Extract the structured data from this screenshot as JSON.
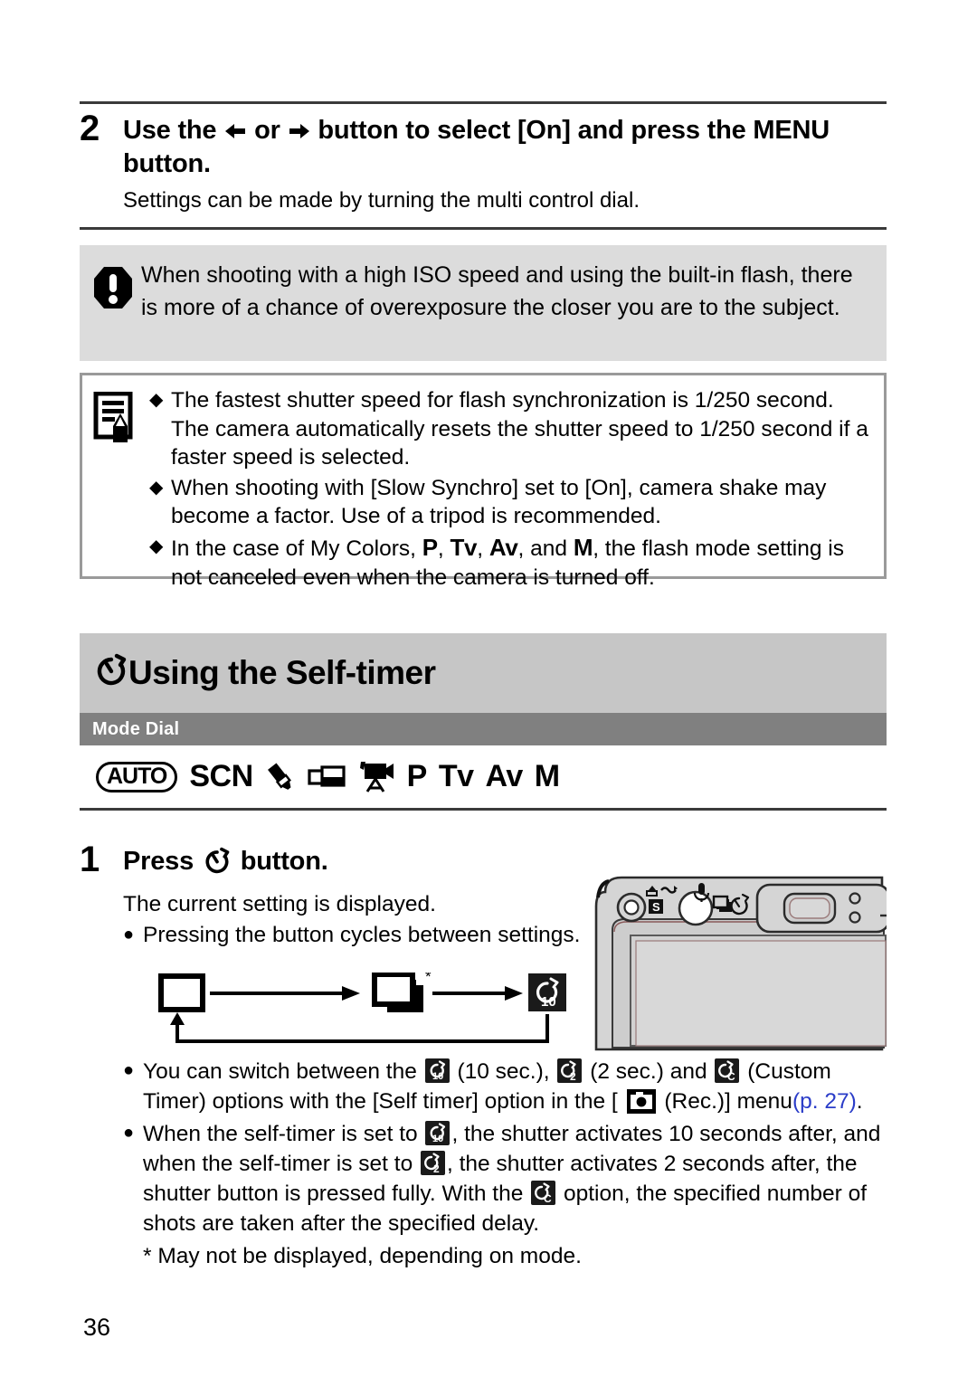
{
  "page": {
    "number": "36",
    "background": "#ffffff"
  },
  "colors": {
    "rule": "#3a3a3a",
    "warn_bg": "#dcdcdc",
    "note_border": "#9a9a9a",
    "section_bg": "#c6c6c6",
    "modebar_bg": "#808080",
    "link": "#2a3cc8"
  },
  "step2": {
    "number": "2",
    "heading_pre": "Use the",
    "icon_left": "left-arrow-icon",
    "heading_or": "or",
    "icon_right": "right-arrow-icon",
    "heading_post": "button to select [On] and press the MENU button.",
    "subtext": "Settings can be made by turning the multi control dial."
  },
  "warning": {
    "icon": "exclamation-octagon-icon",
    "text": "When shooting with a high ISO speed and using the built-in flash, there is more of a chance of overexposure the closer you are to the subject."
  },
  "notes": {
    "icon": "note-pencil-icon",
    "items": [
      {
        "bullet": "◆",
        "text": "The fastest shutter speed for flash synchronization is 1/250 second. The camera automatically resets the shutter speed to 1/250 second if a faster speed is selected."
      },
      {
        "bullet": "◆",
        "text": "When shooting with [Slow Synchro] set to [On], camera shake may become a factor. Use of a tripod is recommended."
      },
      {
        "bullet": "◆",
        "prefix": "In the case of My Colors,",
        "modes": [
          "P",
          "Tv",
          "Av",
          "M"
        ],
        "suffix": ", the flash mode setting is not canceled even when the camera is turned off."
      }
    ]
  },
  "section": {
    "icon": "self-timer-icon",
    "title": "Using the Self-timer",
    "mode_dial_label": "Mode Dial",
    "mode_dial_items": [
      {
        "name": "auto-mode-icon",
        "label": "AUTO",
        "type": "badge"
      },
      {
        "name": "scn-mode-label",
        "label": "SCN",
        "type": "text"
      },
      {
        "name": "color-accent-mode-icon",
        "label": "",
        "type": "icon-brush"
      },
      {
        "name": "stitch-assist-mode-icon",
        "label": "",
        "type": "icon-stitch"
      },
      {
        "name": "movie-mode-icon",
        "label": "",
        "type": "icon-movie"
      },
      {
        "name": "program-mode-label",
        "label": "P",
        "type": "text"
      },
      {
        "name": "tv-mode-label",
        "label": "Tv",
        "type": "text"
      },
      {
        "name": "av-mode-label",
        "label": "Av",
        "type": "text"
      },
      {
        "name": "manual-mode-label",
        "label": "M",
        "type": "text"
      }
    ]
  },
  "step1": {
    "number": "1",
    "heading_pre": "Press",
    "icon": "self-timer-icon",
    "heading_post": "button.",
    "line1": "The current setting is displayed.",
    "bullet1_dot": "●",
    "bullet1": "Pressing the button cycles between settings.",
    "cycle": {
      "items": [
        {
          "name": "single-shot-icon",
          "star": false
        },
        {
          "name": "continuous-shooting-icon",
          "star": true,
          "star_mark": "*"
        },
        {
          "name": "self-timer-10sec-icon",
          "star": false
        }
      ]
    },
    "camera_illustration": {
      "name": "camera-back-illustration",
      "parts": [
        "print-share-button",
        "drive-self-timer-button",
        "microphone-icon",
        "viewfinder",
        "indicator-lamps"
      ]
    }
  },
  "bottom": {
    "b1": {
      "dot": "●",
      "p1": "You can switch between the",
      "icon1": "self-timer-10sec-icon",
      "p2": "(10 sec.),",
      "icon2": "self-timer-2sec-icon",
      "p3": "(2 sec.) and",
      "icon3": "self-timer-custom-icon",
      "p4": "(Custom Timer) options with the [Self timer] option in the [",
      "icon4": "rec-menu-camera-icon",
      "p5": "(Rec.)] menu",
      "ref": "(p. 27)",
      "p6": "."
    },
    "b2": {
      "dot": "●",
      "p1": "When the self-timer is set to",
      "icon1": "self-timer-10sec-icon",
      "p2": ", the shutter activates 10 seconds after, and when the self-timer is set to",
      "icon2": "self-timer-2sec-icon",
      "p3": ", the shutter activates 2 seconds after, the shutter button is pressed fully. With the",
      "icon3": "self-timer-custom-icon",
      "p4": "option, the specified number of shots are taken after the specified delay."
    },
    "footnote": "* May not be displayed, depending on mode."
  }
}
